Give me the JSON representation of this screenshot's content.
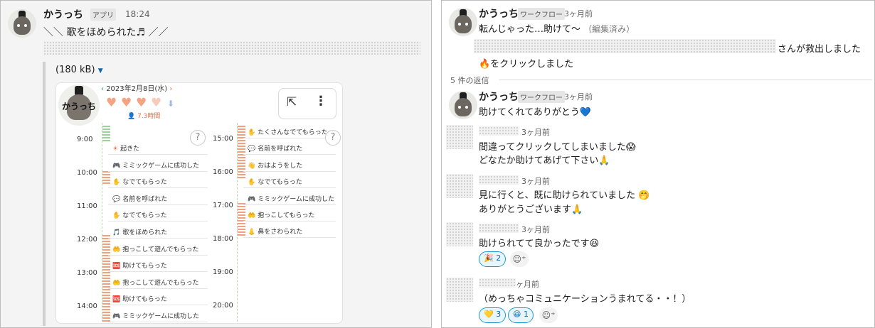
{
  "left": {
    "message": {
      "user": "かうっち",
      "badge": "アプリ",
      "time": "18:24",
      "text": "＼＼ 歌をほめられた♬ ／／"
    },
    "attachment": {
      "size": "(180 kB)",
      "card": {
        "avatar_text": "かうっち",
        "date": "2023年2月8日(水)",
        "duration": "7.3時間",
        "hours_left": [
          "9:00",
          "10:00",
          "11:00",
          "12:00",
          "13:00",
          "14:00"
        ],
        "hours_right": [
          "15:00",
          "16:00",
          "17:00",
          "18:00",
          "19:00",
          "20:00"
        ],
        "events_left": [
          {
            "icon": "☀",
            "label": "起きた"
          },
          {
            "icon": "🎮",
            "label": "ミミックゲームに成功した"
          },
          {
            "icon": "✋",
            "label": "なでてもらった"
          },
          {
            "icon": "💬",
            "label": "名前を呼ばれた"
          },
          {
            "icon": "✋",
            "label": "なでてもらった"
          },
          {
            "icon": "🎵",
            "label": "歌をほめられた"
          },
          {
            "icon": "🤲",
            "label": "抱っこして遊んでもらった"
          },
          {
            "icon": "🆘",
            "label": "助けてもらった"
          },
          {
            "icon": "🤲",
            "label": "抱っこして遊んでもらった"
          },
          {
            "icon": "🆘",
            "label": "助けてもらった"
          },
          {
            "icon": "🎮",
            "label": "ミミックゲームに成功した"
          }
        ],
        "events_right": [
          {
            "icon": "✋",
            "label": "たくさんなでてもらった"
          },
          {
            "icon": "💬",
            "label": "名前を呼ばれた"
          },
          {
            "icon": "👋",
            "label": "おはようをした"
          },
          {
            "icon": "✋",
            "label": "なでてもらった"
          },
          {
            "icon": "🎮",
            "label": "ミミックゲームに成功した"
          },
          {
            "icon": "🤲",
            "label": "抱っこしてもらった"
          },
          {
            "icon": "👃",
            "label": "鼻をさわられた"
          }
        ],
        "help_glyph": "?",
        "open_glyph": "⇱",
        "more_glyph": "⋮"
      }
    }
  },
  "right": {
    "parent": {
      "user": "かうっち",
      "badge": "ワークフロー",
      "time": "3ヶ月前",
      "text": "転んじゃった…助けて〜",
      "edited": "（編集済み）",
      "rescued": "さんが救出しました",
      "clicked": "🔥をクリックしました"
    },
    "reply_count": "5 件の返信",
    "replies": [
      {
        "user": "かうっち",
        "badge": "ワークフロー",
        "time": "3ヶ月前",
        "lines": [
          "助けてくれてありがとう💙"
        ]
      },
      {
        "time": "3ヶ月前",
        "lines": [
          "間違ってクリックしてしまいました😱",
          "どなたか助けてあげて下さい🙏"
        ]
      },
      {
        "time": "3ヶ月前",
        "lines": [
          "見に行くと、既に助けられていました 🤭",
          "ありがとうございます🙏"
        ]
      },
      {
        "time": "3ヶ月前",
        "lines": [
          "助けられてて良かったです😆"
        ],
        "reactions": [
          {
            "emoji": "🎉",
            "count": "2"
          }
        ]
      },
      {
        "time": "ヶ月前",
        "lines": [
          "（めっちゃコミュニケーションうまれてる・・！）"
        ],
        "reactions": [
          {
            "emoji": "💛",
            "count": "3"
          },
          {
            "emoji": "😆",
            "count": "1"
          }
        ]
      }
    ],
    "add_reaction_glyph": "☺⁺"
  },
  "colors": {
    "accent": "#1264a3",
    "heart": "#f4a482",
    "event_icon": "#e8744f"
  }
}
